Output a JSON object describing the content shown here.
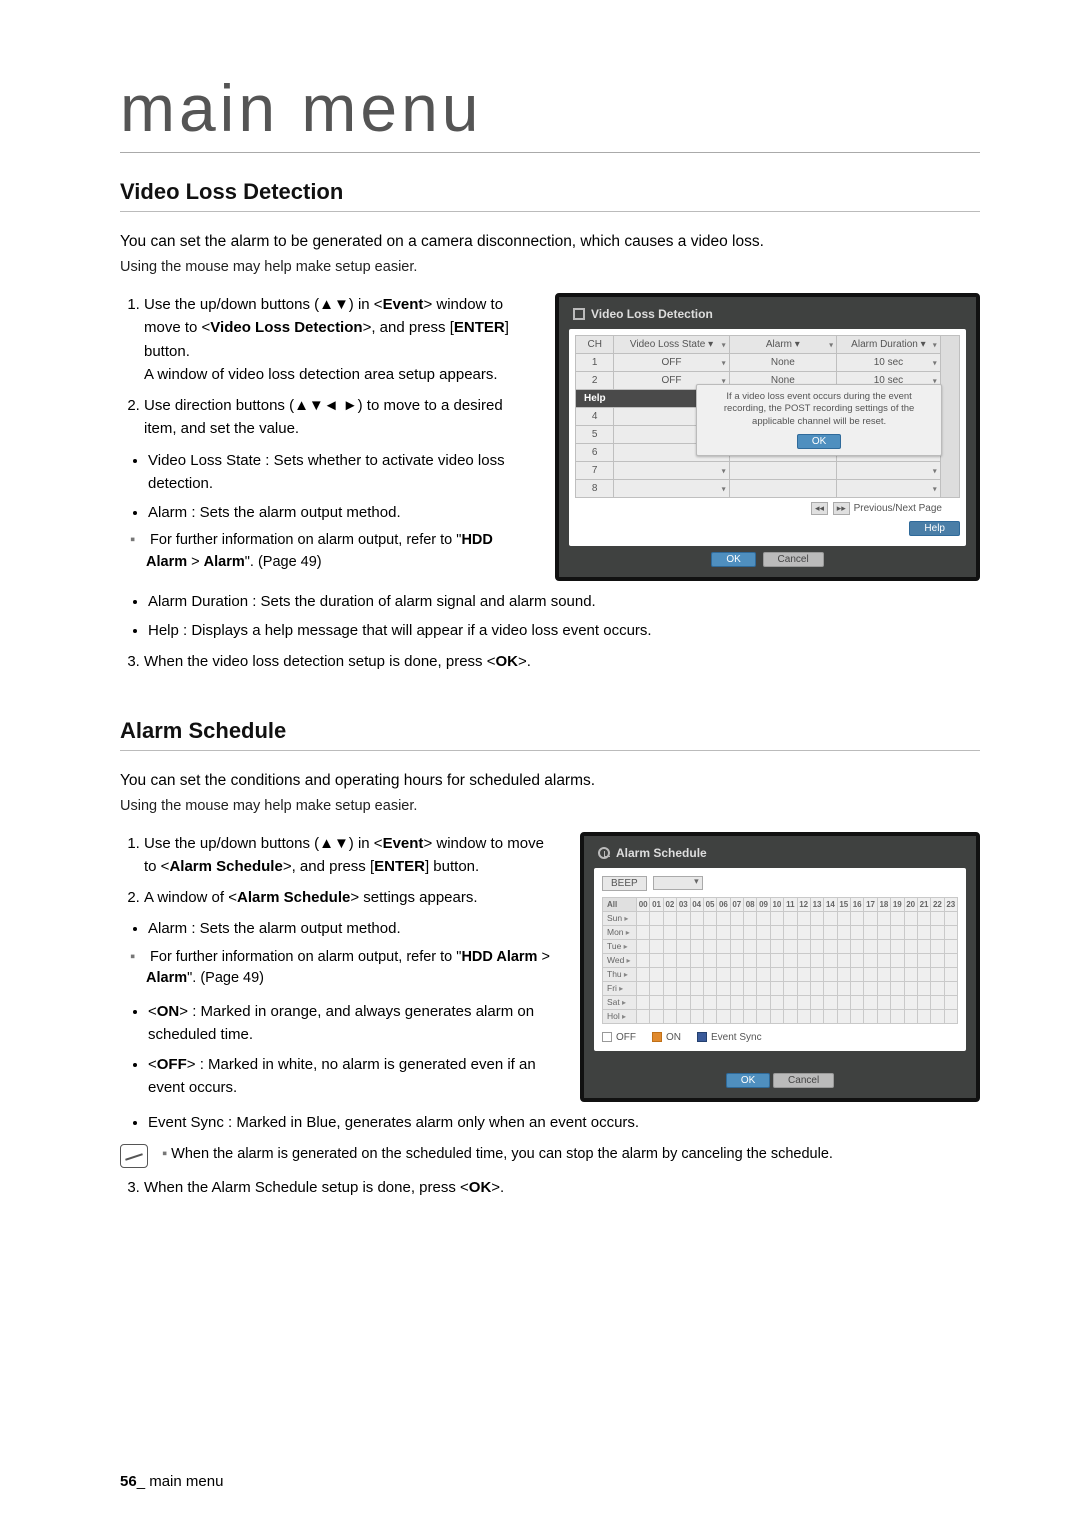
{
  "header": {
    "title": "main menu"
  },
  "vld": {
    "heading": "Video Loss Detection",
    "intro": "You can set the alarm to be generated on a camera disconnection, which causes a video loss.",
    "sub": "Using the mouse may help make setup easier.",
    "step1a": "Use the up/down buttons (▲▼) in <",
    "step1_event": "Event",
    "step1b": "> window to move to <",
    "step1_vld": "Video Loss Detection",
    "step1c": ">, and press [",
    "step1_enter": "ENTER",
    "step1d": "] button.",
    "step1_line2": "A window of video loss detection area setup appears.",
    "step2": "Use direction buttons (▲▼◄ ►) to move to a desired item, and set the value.",
    "b_state": "Video Loss State : Sets whether to activate video loss detection.",
    "b_alarm": "Alarm : Sets the alarm output method.",
    "sub_alarm_a": "For further information on alarm output, refer to \"",
    "sub_alarm_b": "HDD Alarm",
    "sub_alarm_c": " > ",
    "sub_alarm_d": "Alarm",
    "sub_alarm_e": "\". (Page 49)",
    "b_dur": "Alarm Duration : Sets the duration of alarm signal and alarm sound.",
    "b_help": "Help : Displays a help message that will appear if a video loss event occurs.",
    "step3a": "When the video loss detection setup is done, press <",
    "step3_ok": "OK",
    "step3b": ">.",
    "shot": {
      "title": "Video Loss Detection",
      "cols": {
        "ch": "CH",
        "state": "Video Loss State ▾",
        "alarm": "Alarm ▾",
        "dur": "Alarm Duration ▾"
      },
      "rows": [
        {
          "ch": "1",
          "state": "OFF",
          "alarm": "None",
          "dur": "10 sec"
        },
        {
          "ch": "2",
          "state": "OFF",
          "alarm": "None",
          "dur": "10 sec"
        }
      ],
      "help": "Help",
      "tip1": "If a video loss event occurs during the event",
      "tip2": "recording, the POST recording settings of the",
      "tip3": "applicable channel will be reset.",
      "ok": "OK",
      "pager": "Previous/Next Page",
      "helpbtn": "Help",
      "okbtn": "OK",
      "cancel": "Cancel"
    }
  },
  "as": {
    "heading": "Alarm Schedule",
    "intro": "You can set the conditions and operating hours for scheduled alarms.",
    "sub": "Using the mouse may help make setup easier.",
    "step1a": "Use the up/down buttons (▲▼) in <",
    "step1_event": "Event",
    "step1b": "> window to move to <",
    "step1_as": "Alarm Schedule",
    "step1c": ">, and press [",
    "step1_enter": "ENTER",
    "step1d": "] button.",
    "step2a": "A window of <",
    "step2_as": "Alarm Schedule",
    "step2b": "> settings appears.",
    "b_alarm": "Alarm : Sets the alarm output method.",
    "sub_alarm_a": "For further information on alarm output, refer to \"",
    "sub_alarm_b": "HDD Alarm",
    "sub_alarm_c": " > ",
    "sub_alarm_d": "Alarm",
    "sub_alarm_e": "\". (Page 49)",
    "b_on_a": "<",
    "b_on_b": "ON",
    "b_on_c": "> : Marked in orange, and always generates alarm on scheduled time.",
    "b_off_a": "<",
    "b_off_b": "OFF",
    "b_off_c": "> : Marked in white, no alarm is generated even if an event occurs.",
    "b_ev": "Event Sync : Marked in Blue, generates alarm only when an event occurs.",
    "note": "When the alarm is generated on the scheduled time, you can stop the alarm by canceling the schedule.",
    "step3a": "When the Alarm Schedule setup is done, press <",
    "step3_ok": "OK",
    "step3b": ">.",
    "shot": {
      "title": "Alarm Schedule",
      "beep": "BEEP",
      "all": "All",
      "hours": [
        "00",
        "01",
        "02",
        "03",
        "04",
        "05",
        "06",
        "07",
        "08",
        "09",
        "10",
        "11",
        "12",
        "13",
        "14",
        "15",
        "16",
        "17",
        "18",
        "19",
        "20",
        "21",
        "22",
        "23"
      ],
      "days": [
        "Sun",
        "Mon",
        "Tue",
        "Wed",
        "Thu",
        "Fri",
        "Sat",
        "Hol"
      ],
      "leg_off": "OFF",
      "leg_on": "ON",
      "leg_ev": "Event Sync",
      "okbtn": "OK",
      "cancel": "Cancel"
    }
  },
  "footer": {
    "page": "56",
    "sep": "_ ",
    "label": "main menu"
  }
}
